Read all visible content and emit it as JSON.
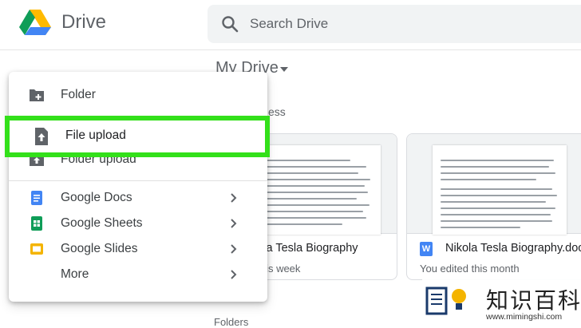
{
  "header": {
    "brand": "Drive",
    "search_placeholder": "Search Drive"
  },
  "main": {
    "title": "My Drive",
    "quick_access_label": "ess",
    "folders_label": "Folders",
    "files": [
      {
        "name": "kola Tesla Biography",
        "subtitle": "ı this week"
      },
      {
        "name": "Nikola Tesla Biography.docx",
        "subtitle": "You edited this month",
        "type_icon": "W"
      }
    ]
  },
  "new_menu": {
    "items": [
      {
        "label": "Folder",
        "icon": "folder-plus-icon"
      },
      {
        "label": "File upload",
        "icon": "file-upload-icon",
        "highlighted": true
      },
      {
        "label": "Folder upload",
        "icon": "folder-upload-icon"
      },
      {
        "label": "Google Docs",
        "icon": "google-docs-icon"
      },
      {
        "label": "Google Sheets",
        "icon": "google-sheets-icon"
      },
      {
        "label": "Google Slides",
        "icon": "google-slides-icon"
      },
      {
        "label": "More",
        "icon": ""
      }
    ]
  },
  "watermark": {
    "title": "知识百科",
    "url": "www.mimingshi.com"
  },
  "colors": {
    "highlight": "#33e01a",
    "docs": "#4285f4",
    "sheets": "#0f9d58",
    "slides": "#f4b400"
  }
}
